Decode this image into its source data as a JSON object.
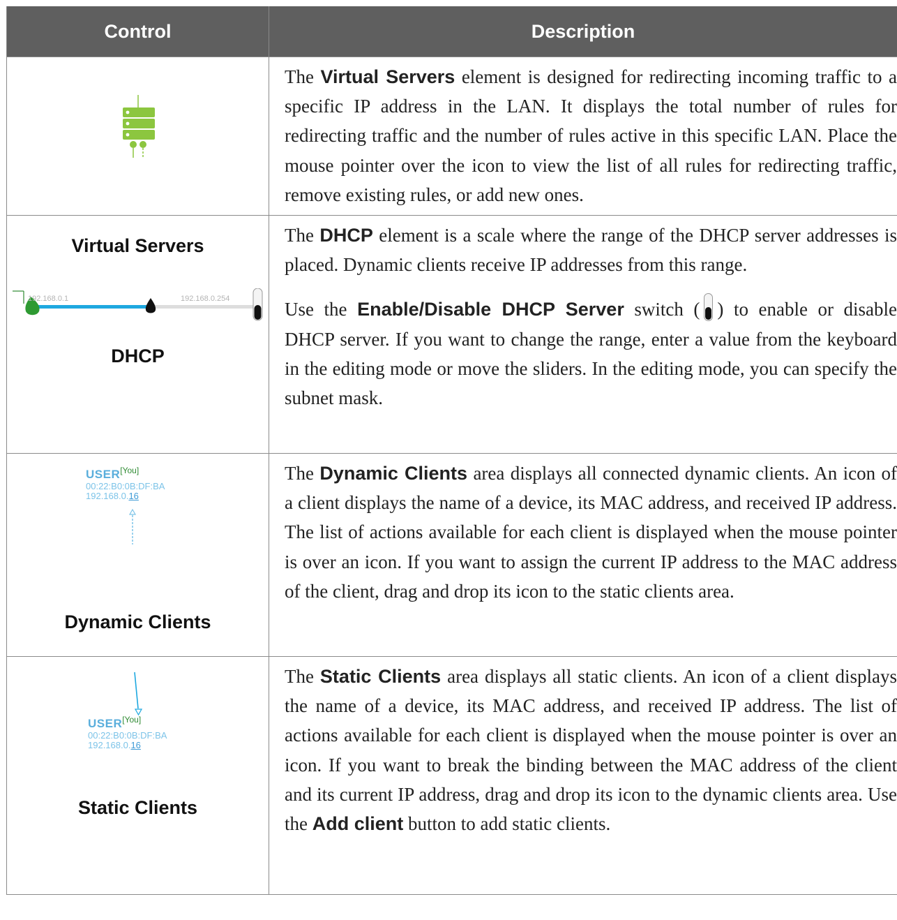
{
  "header": {
    "control": "Control",
    "description": "Description"
  },
  "rows": [
    {
      "control": "Virtual Servers",
      "description": {
        "pre": "The ",
        "bold": "Virtual Servers",
        "post": " element is designed for redirecting incoming traffic to a specific IP address in the LAN. It displays the total number of rules for redirecting traffic and the number of rules active in this specific LAN. Place the mouse pointer over the icon to view the list of all rules for redirecting traffic, remove existing rules, or add new ones."
      },
      "icon": "server-stack-icon"
    },
    {
      "control": "DHCP",
      "description": {
        "pre": "The ",
        "bold": "DHCP",
        "post": " element is a scale where the range of the DHCP server addresses is placed. Dynamic clients receive IP addresses from this range.",
        "p2_pre": "Use the ",
        "p2_bold": "Enable/Disable DHCP Server",
        "p2_mid": " switch (",
        "p2_post": ") to enable or disable DHCP server. If you want to change the range, enter a value from the keyboard in the editing mode or move the sliders. In the editing mode, you can specify the subnet mask."
      },
      "range_start": "192.168.0.1",
      "range_end": "192.168.0.254",
      "icon": "toggle-switch-icon"
    },
    {
      "control": "Dynamic Clients",
      "description": {
        "pre": "The ",
        "bold": "Dynamic Clients",
        "post": " area displays all connected dynamic clients. An icon of a client displays the name of a device, its MAC address, and received IP address. The list of actions available for each client is displayed when the mouse pointer is over an icon. If you want to assign the current IP address to the MAC address of the client, drag and drop its icon to the static clients area."
      },
      "client": {
        "name": "USER",
        "tag": "[You]",
        "mac": "00:22:B0:0B:DF:BA",
        "ip_prefix": "192.168.0.",
        "ip_suffix": "16"
      }
    },
    {
      "control": "Static Clients",
      "description": {
        "pre": "The ",
        "bold": "Static Clients",
        "post": " area displays all static clients. An icon of a client displays the name of a device, its MAC address, and received IP address. The list of actions available for each client is displayed when the mouse pointer is over an icon. If you want to break the binding between the MAC address of the client and its current IP address, drag and drop its icon to the dynamic clients area. Use the ",
        "bold2": "Add client",
        "post2": " button to add static clients."
      },
      "client": {
        "name": "USER",
        "tag": "[You]",
        "mac": "00:22:B0:0B:DF:BA",
        "ip_prefix": "192.168.0.",
        "ip_suffix": "16"
      }
    }
  ],
  "colors": {
    "header_bg": "#5f5f5f",
    "server_green": "#8cc63f",
    "slider_blue": "#1ea8e0",
    "client_blue": "#7cc3e8",
    "you_green": "#2e8a32"
  }
}
